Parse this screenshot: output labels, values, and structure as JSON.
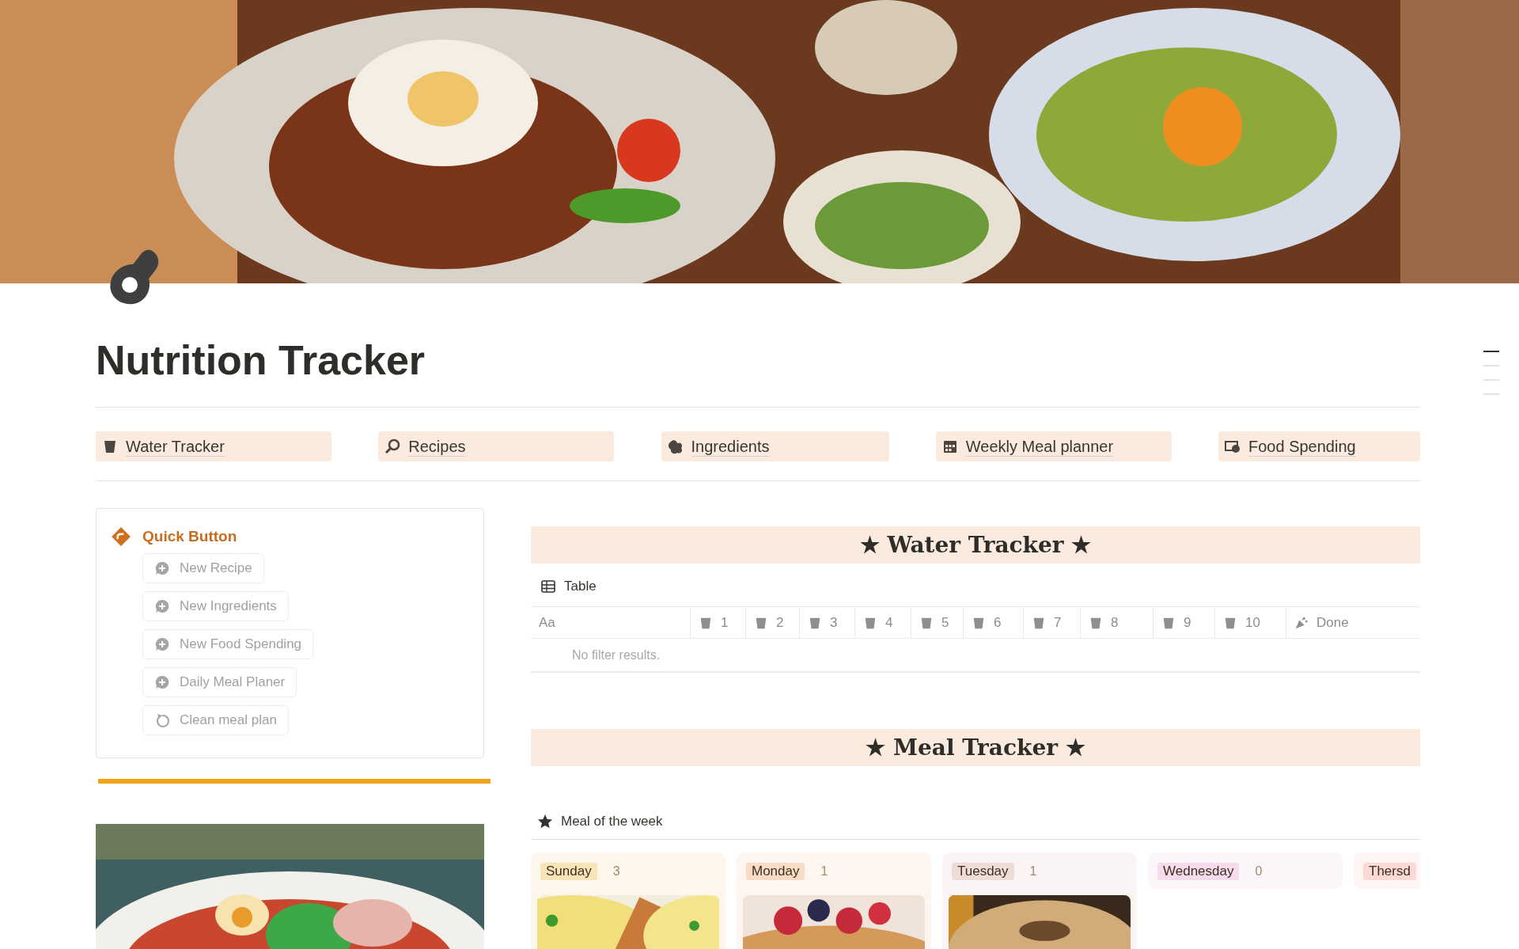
{
  "page_title": "Nutrition Tracker",
  "nav_links": [
    {
      "label": "Water Tracker",
      "kind": "cup"
    },
    {
      "label": "Recipes",
      "kind": "search"
    },
    {
      "label": "Ingredients",
      "kind": "blob"
    },
    {
      "label": "Weekly Meal planner",
      "kind": "calendar"
    },
    {
      "label": "Food Spending",
      "kind": "money"
    }
  ],
  "quick_buttons": {
    "title": "Quick Button",
    "buttons": [
      {
        "label": "New Recipe",
        "kind": "add"
      },
      {
        "label": "New Ingredients",
        "kind": "add"
      },
      {
        "label": "New Food Spending",
        "kind": "add"
      },
      {
        "label": "Daily Meal Planer",
        "kind": "add"
      },
      {
        "label": "Clean meal plan",
        "kind": "reset"
      }
    ]
  },
  "water_tracker": {
    "heading": "★ Water Tracker ★",
    "view": "Table",
    "columns": [
      {
        "label": "Aa",
        "kind": "title"
      },
      {
        "label": "1",
        "kind": "cup"
      },
      {
        "label": "2",
        "kind": "cup"
      },
      {
        "label": "3",
        "kind": "cup"
      },
      {
        "label": "4",
        "kind": "cup"
      },
      {
        "label": "5",
        "kind": "cup"
      },
      {
        "label": "6",
        "kind": "cup"
      },
      {
        "label": "7",
        "kind": "cup"
      },
      {
        "label": "8",
        "kind": "cup"
      },
      {
        "label": "9",
        "kind": "cup"
      },
      {
        "label": "10",
        "kind": "cup"
      },
      {
        "label": "Done",
        "kind": "party"
      }
    ],
    "empty_message": "No filter results."
  },
  "meal_tracker": {
    "heading": "★ Meal Tracker ★",
    "view": "Meal of the week",
    "groups": [
      {
        "label": "Sunday",
        "count": "3",
        "color": "#f9e4b7"
      },
      {
        "label": "Monday",
        "count": "1",
        "color": "#f8dcc6"
      },
      {
        "label": "Tuesday",
        "count": "1",
        "color": "#eeddd6"
      },
      {
        "label": "Wednesday",
        "count": "0",
        "color": "#f5dbeb"
      },
      {
        "label": "Thersd",
        "color": "#fbd9d5"
      }
    ]
  }
}
